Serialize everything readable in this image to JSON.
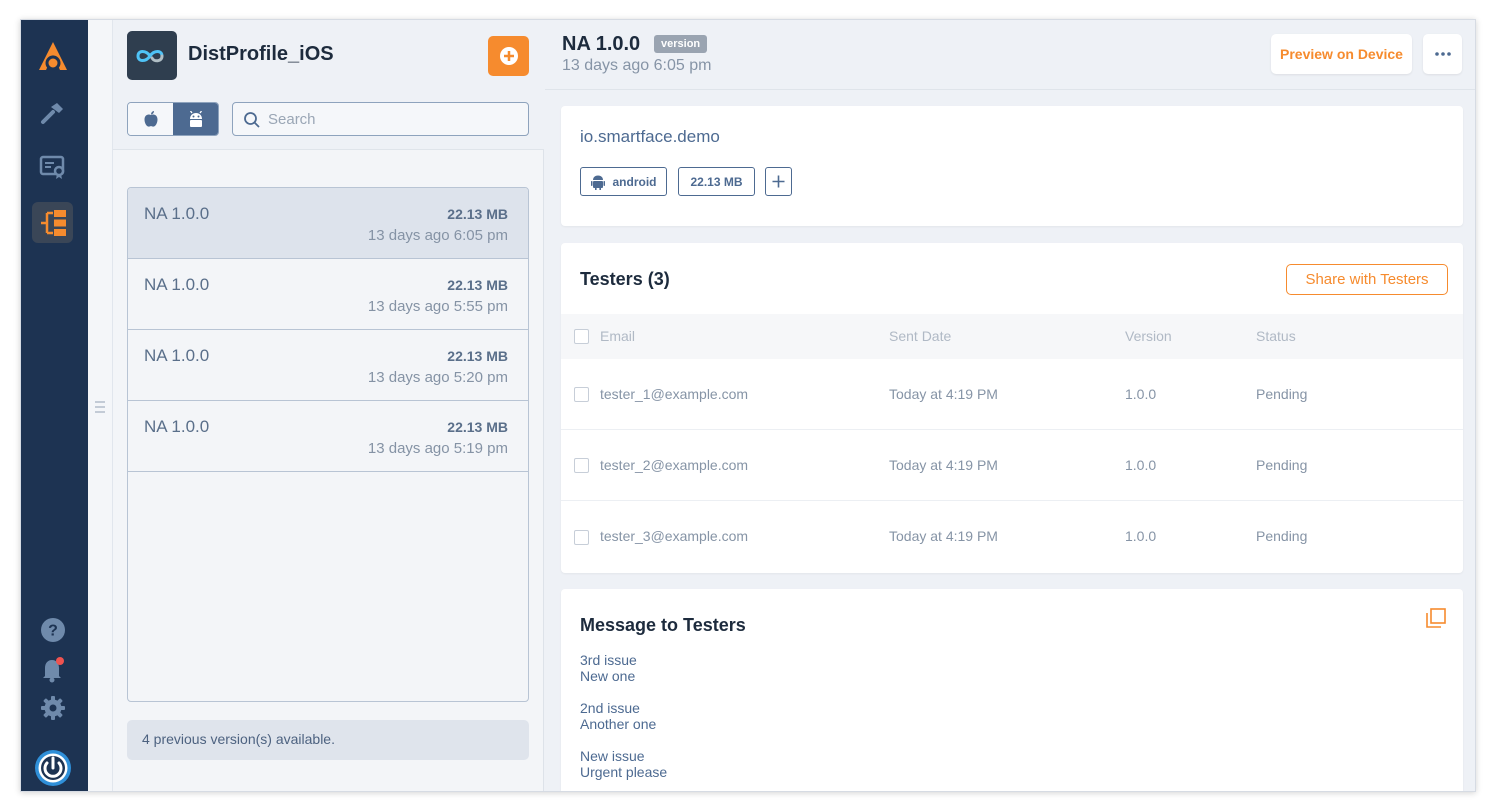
{
  "app": {
    "name": "DistProfile_iOS"
  },
  "search": {
    "placeholder": "Search"
  },
  "versions": [
    {
      "name": "NA 1.0.0",
      "size": "22.13 MB",
      "date": "13 days ago 6:05 pm",
      "selected": true
    },
    {
      "name": "NA 1.0.0",
      "size": "22.13 MB",
      "date": "13 days ago 5:55 pm",
      "selected": false
    },
    {
      "name": "NA 1.0.0",
      "size": "22.13 MB",
      "date": "13 days ago 5:20 pm",
      "selected": false
    },
    {
      "name": "NA 1.0.0",
      "size": "22.13 MB",
      "date": "13 days ago 5:19 pm",
      "selected": false
    }
  ],
  "previous_versions_text": "4 previous version(s) available.",
  "detail": {
    "title": "NA 1.0.0",
    "badge": "version",
    "subtitle": "13 days ago 6:05 pm",
    "preview_label": "Preview on Device",
    "package": "io.smartface.demo",
    "platform": "android",
    "size": "22.13 MB"
  },
  "testers": {
    "heading": "Testers (3)",
    "share_label": "Share with Testers",
    "columns": [
      "Email",
      "Sent Date",
      "Version",
      "Status"
    ],
    "rows": [
      {
        "email": "tester_1@example.com",
        "sent": "Today at 4:19 PM",
        "version": "1.0.0",
        "status": "Pending"
      },
      {
        "email": "tester_2@example.com",
        "sent": "Today at 4:19 PM",
        "version": "1.0.0",
        "status": "Pending"
      },
      {
        "email": "tester_3@example.com",
        "sent": "Today at 4:19 PM",
        "version": "1.0.0",
        "status": "Pending"
      }
    ]
  },
  "message": {
    "heading": "Message to Testers",
    "blocks": [
      [
        "3rd issue",
        "New one"
      ],
      [
        "2nd issue",
        "Another one"
      ],
      [
        "New issue",
        "Urgent please"
      ]
    ]
  },
  "colors": {
    "accent": "#f68b2e",
    "sidebar": "#1d3352",
    "link": "#4d6a91"
  },
  "icons": {
    "rail": [
      "appcircle-logo-icon",
      "build-hammer-icon",
      "signing-certificate-icon",
      "distribution-icon",
      "help-icon",
      "notification-bell-icon",
      "settings-gear-icon",
      "power-icon"
    ]
  }
}
